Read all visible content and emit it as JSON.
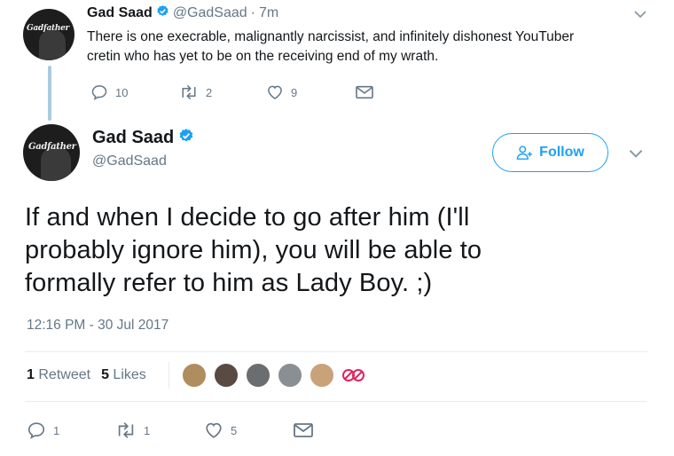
{
  "parent_tweet": {
    "display_name": "Gad Saad",
    "handle": "@GadSaad",
    "separator": "·",
    "time_ago": "7m",
    "text_line1": "There is one execrable, malignantly narcissist, and infinitely dishonest YouTuber",
    "text_line2": "cretin who has yet to be on the receiving end of my wrath.",
    "avatar_text": "Gadfather",
    "reply_count": "10",
    "retweet_count": "2",
    "like_count": "9"
  },
  "main_tweet": {
    "display_name": "Gad Saad",
    "handle": "@GadSaad",
    "avatar_text": "Gadfather",
    "follow_label": "Follow",
    "text_line1": "If and when I decide to go after him (I'll",
    "text_line2": "probably ignore him), you will be able to",
    "text_line3": "formally refer to him as Lady Boy. ;)",
    "timestamp": "12:16 PM - 30 Jul 2017",
    "retweets_num": "1",
    "retweets_label": "Retweet",
    "likes_num": "5",
    "likes_label": "Likes",
    "reply_count": "1",
    "retweet_count": "1",
    "like_count": "5"
  },
  "likers": [
    {
      "name": "liker-1",
      "color": "#b08d5e"
    },
    {
      "name": "liker-2",
      "color": "#5a4a44"
    },
    {
      "name": "liker-3",
      "color": "#6b6e70"
    },
    {
      "name": "liker-4",
      "color": "#8a8f94"
    },
    {
      "name": "liker-5",
      "color": "#c9a27a"
    }
  ],
  "colors": {
    "accent": "#1da1f2",
    "verified": "#1da1f2",
    "text_secondary": "#657786",
    "thread_line": "#aacbe0",
    "divider": "#e6ecf0",
    "no_sign": "#e0245e"
  },
  "icons": [
    "reply-icon",
    "retweet-icon",
    "heart-icon",
    "envelope-icon",
    "chevron-down-icon",
    "verified-badge-icon",
    "follow-person-icon",
    "no-sign-icon"
  ]
}
